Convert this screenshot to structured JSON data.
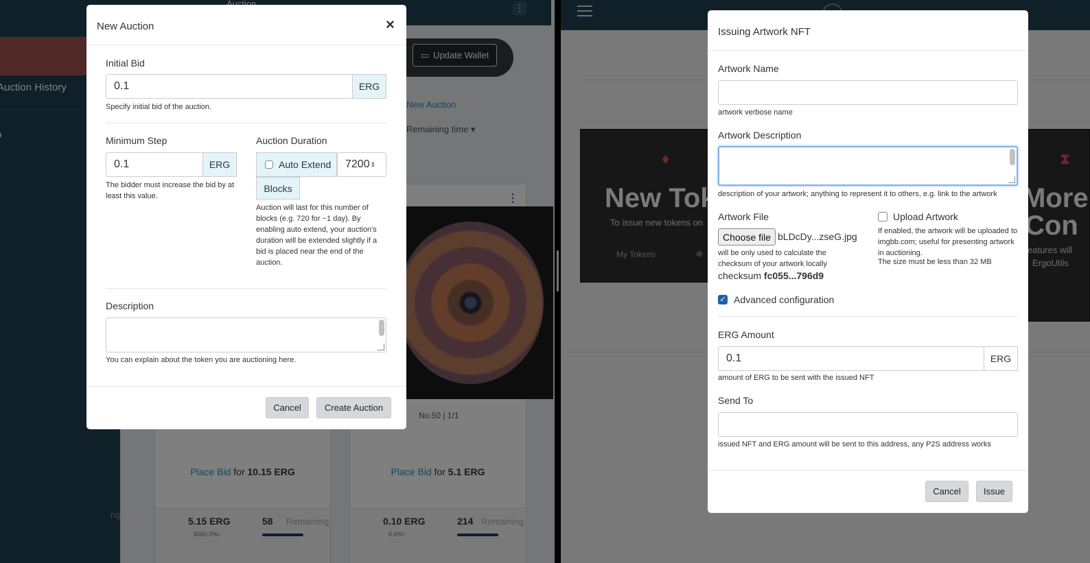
{
  "left_app": {
    "topbar_title": "Auction",
    "sidebar_item": "Auction History",
    "sidebar_item2": "o",
    "wallet_button": "Update Wallet",
    "new_auction_link": "New Auction",
    "remaining_sort": "Remaining time ▾",
    "cards": [
      {
        "number": "",
        "bid_link": "Place Bid",
        "bid_for": " for ",
        "bid_amount": "10.15 ERG",
        "amount": "5.15 ERG",
        "amount_sub": "5050.0%↑",
        "remaining": "58",
        "remaining_label": "Remaining"
      },
      {
        "number": "No.50 | 1/1",
        "bid_link": "Place Bid",
        "bid_for": " for ",
        "bid_amount": "5.1 ERG",
        "amount": "0.10 ERG",
        "amount_sub": "0.0%↑",
        "remaining": "214",
        "remaining_label": "Remaining"
      }
    ],
    "fragment": "ng"
  },
  "new_auction_modal": {
    "title": "New Auction",
    "close": "×",
    "initial_bid": {
      "label": "Initial Bid",
      "value": "0.1",
      "unit": "ERG",
      "help": "Specify initial bid of the auction."
    },
    "minimum_step": {
      "label": "Minimum Step",
      "value": "0.1",
      "unit": "ERG",
      "help": "The bidder must increase the bid by at least this value."
    },
    "auction_duration": {
      "label": "Auction Duration",
      "auto_extend_label": "Auto Extend",
      "auto_extend_checked": false,
      "value": "7200",
      "unit": "Blocks",
      "help": "Auction will last for this number of blocks (e.g. 720 for ~1 day). By enabling auto extend, your auction's duration will be extended slightly if a bid is placed near the end of the auction."
    },
    "description": {
      "label": "Description",
      "value": "",
      "help": "You can explain about the token you are auctioning here."
    },
    "cancel": "Cancel",
    "submit": "Create Auction"
  },
  "right_app": {
    "tile1_title": "New Toke",
    "tile1_sub": "To issue new tokens on",
    "tile1_link": "My Tokens",
    "tile2_title": "More",
    "tile2_title2": "Con",
    "tile2_sub": "eatures will",
    "tile2_sub2": "ErgoUtils"
  },
  "nft_modal": {
    "title": "Issuing Artwork NFT",
    "artwork_name": {
      "label": "Artwork Name",
      "value": "",
      "help": "artwork verbose name"
    },
    "artwork_description": {
      "label": "Artwork Description",
      "value": "",
      "help": "description of your artwork; anything to represent it to others, e.g. link to the artwork"
    },
    "artwork_file": {
      "label": "Artwork File",
      "button": "Choose file",
      "filename": "bLDcDy...zseG.jpg",
      "help": "will be only used to calculate the checksum of your artwork locally",
      "checksum_label": "checksum ",
      "checksum_value": "fc055...796d9"
    },
    "upload_artwork": {
      "label": "Upload Artwork",
      "checked": false,
      "help": "If enabled, the artwork will be uploaded to imgbb.com; useful for presenting artwork in auctioning.",
      "help2": "The size must be less than 32 MB"
    },
    "advanced": {
      "label": "Advanced configuration",
      "checked": true
    },
    "erg_amount": {
      "label": "ERG Amount",
      "value": "0.1",
      "unit": "ERG",
      "help": "amount of ERG to be sent with the issued NFT"
    },
    "send_to": {
      "label": "Send To",
      "value": "",
      "help": "issued NFT and ERG amount will be sent to this address, any P2S address works"
    },
    "cancel": "Cancel",
    "submit": "Issue"
  }
}
